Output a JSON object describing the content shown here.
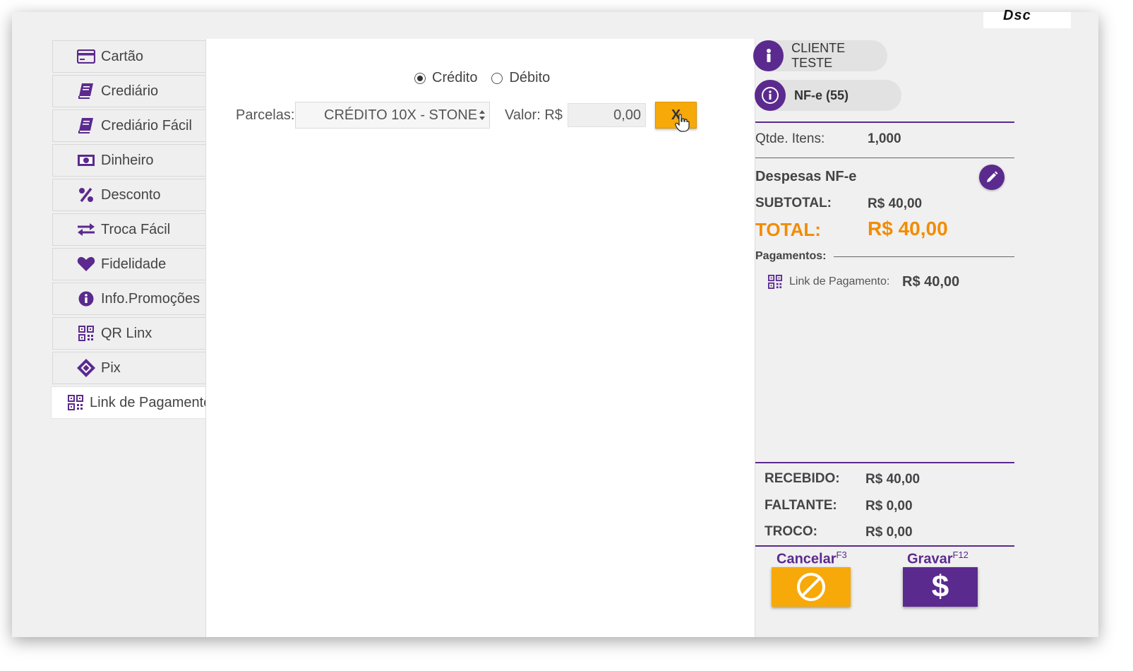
{
  "logo": {
    "text": "Dsc"
  },
  "sidebar": {
    "items": [
      {
        "label": "Cartão",
        "icon": "credit-card-icon"
      },
      {
        "label": "Crediário",
        "icon": "book-icon"
      },
      {
        "label": "Crediário Fácil",
        "icon": "book-icon"
      },
      {
        "label": "Dinheiro",
        "icon": "money-icon"
      },
      {
        "label": "Desconto",
        "icon": "percent-icon"
      },
      {
        "label": "Troca Fácil",
        "icon": "exchange-icon"
      },
      {
        "label": "Fidelidade",
        "icon": "heart-icon"
      },
      {
        "label": "Info.Promoções",
        "icon": "info-icon"
      },
      {
        "label": "QR Linx",
        "icon": "qr-icon"
      },
      {
        "label": "Pix",
        "icon": "pix-icon"
      },
      {
        "label": "Link de Pagamento",
        "icon": "qr-icon",
        "active": true
      }
    ]
  },
  "main": {
    "radio_credito": "Crédito",
    "radio_debito": "Débito",
    "selected": "Crédito",
    "parcelas_label": "Parcelas:",
    "parcelas_value": "CRÉDITO 10X - STONE",
    "valor_label": "Valor: R$",
    "valor_value": "0,00",
    "x_label": "X"
  },
  "right": {
    "cliente": "CLIENTE TESTE",
    "nfe": "NF-e (55)",
    "qtde_label": "Qtde. Itens:",
    "qtde_value": "1,000",
    "despesas_label": "Despesas NF-e",
    "subtotal_label": "SUBTOTAL:",
    "subtotal_value": "R$ 40,00",
    "total_label": "TOTAL:",
    "total_value": "R$ 40,00",
    "pagamentos_label": "Pagamentos:",
    "pagamentos": [
      {
        "label": "Link de Pagamento:",
        "value": "R$ 40,00"
      }
    ],
    "recebido_label": "RECEBIDO:",
    "recebido_value": "R$ 40,00",
    "faltante_label": "FALTANTE:",
    "faltante_value": "R$ 0,00",
    "troco_label": "TROCO:",
    "troco_value": "R$ 0,00",
    "cancelar_label": "Cancelar",
    "cancelar_key": "F3",
    "gravar_label": "Gravar",
    "gravar_key": "F12",
    "gravar_symbol": "$"
  },
  "colors": {
    "purple": "#5b2a8e",
    "orange": "#f28c00",
    "yellow": "#f7a90a"
  }
}
